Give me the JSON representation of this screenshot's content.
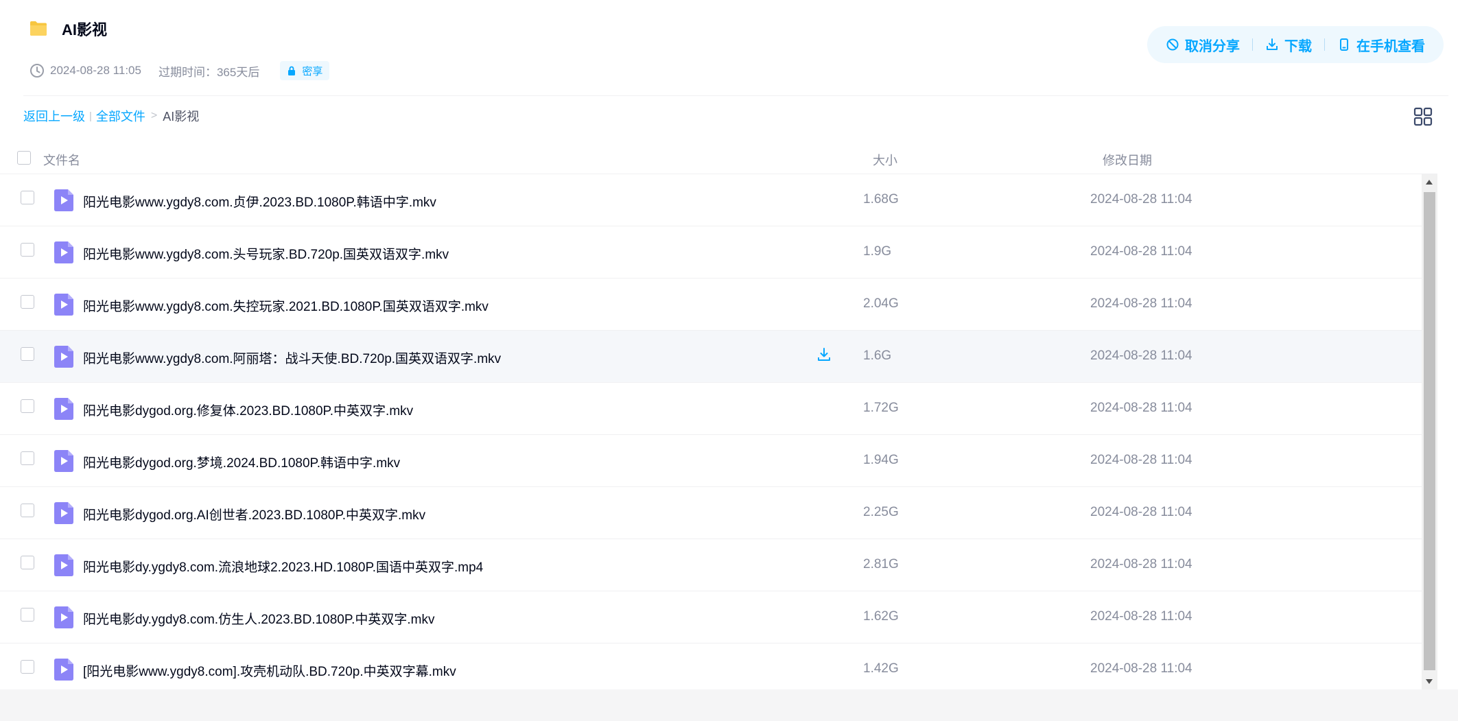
{
  "header": {
    "title": "AI影视",
    "date": "2024-08-28 11:05",
    "expire": "过期时间：365天后",
    "badge": "密享"
  },
  "actions": {
    "cancel_share": "取消分享",
    "download": "下载",
    "view_on_phone": "在手机查看"
  },
  "breadcrumb": {
    "back": "返回上一级",
    "pipe": "|",
    "all_files": "全部文件",
    "arrow": ">",
    "current": "AI影视"
  },
  "columns": {
    "name": "文件名",
    "size": "大小",
    "date": "修改日期"
  },
  "files": [
    {
      "name": "阳光电影www.ygdy8.com.贞伊.2023.BD.1080P.韩语中字.mkv",
      "size": "1.68G",
      "date": "2024-08-28 11:04"
    },
    {
      "name": "阳光电影www.ygdy8.com.头号玩家.BD.720p.国英双语双字.mkv",
      "size": "1.9G",
      "date": "2024-08-28 11:04"
    },
    {
      "name": "阳光电影www.ygdy8.com.失控玩家.2021.BD.1080P.国英双语双字.mkv",
      "size": "2.04G",
      "date": "2024-08-28 11:04"
    },
    {
      "name": "阳光电影www.ygdy8.com.阿丽塔：战斗天使.BD.720p.国英双语双字.mkv",
      "size": "1.6G",
      "date": "2024-08-28 11:04",
      "hovered": true
    },
    {
      "name": "阳光电影dygod.org.修复体.2023.BD.1080P.中英双字.mkv",
      "size": "1.72G",
      "date": "2024-08-28 11:04"
    },
    {
      "name": "阳光电影dygod.org.梦境.2024.BD.1080P.韩语中字.mkv",
      "size": "1.94G",
      "date": "2024-08-28 11:04"
    },
    {
      "name": "阳光电影dygod.org.AI创世者.2023.BD.1080P.中英双字.mkv",
      "size": "2.25G",
      "date": "2024-08-28 11:04"
    },
    {
      "name": "阳光电影dy.ygdy8.com.流浪地球2.2023.HD.1080P.国语中英双字.mp4",
      "size": "2.81G",
      "date": "2024-08-28 11:04"
    },
    {
      "name": "阳光电影dy.ygdy8.com.仿生人.2023.BD.1080P.中英双字.mkv",
      "size": "1.62G",
      "date": "2024-08-28 11:04"
    },
    {
      "name": "[阳光电影www.ygdy8.com].攻壳机动队.BD.720p.中英双字幕.mkv",
      "size": "1.42G",
      "date": "2024-08-28 11:04"
    }
  ],
  "colors": {
    "accent": "#06a7ff",
    "file_icon": "#8c84f7",
    "folder": "#f7c640"
  },
  "icons": {
    "folder": "folder-icon",
    "clock": "clock-icon",
    "lock": "lock-icon",
    "cancel": "ban-icon",
    "download": "download-icon",
    "phone": "phone-icon",
    "grid": "grid-view-icon",
    "video": "video-file-icon"
  }
}
